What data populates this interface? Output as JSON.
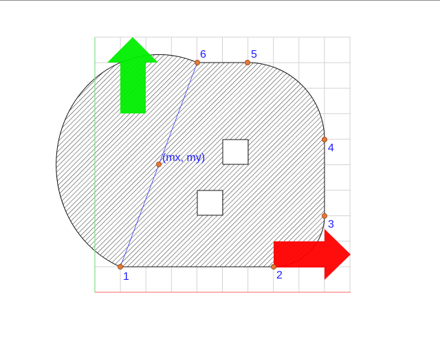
{
  "colors": {
    "grid": "#d2d2d2",
    "x_axis": "#ff8080",
    "y_axis": "#7fe07f",
    "hatch": "#111111",
    "shape_fill": "#ffffff",
    "outline": "#111111",
    "chord": "#4a4af0",
    "point_fill": "#e07a3a",
    "point_stroke": "#9a3f10",
    "label": "#1a1aff",
    "x_arrow": "#ff0000",
    "y_arrow": "#00ee00"
  },
  "points": [
    {
      "label": "1"
    },
    {
      "label": "2"
    },
    {
      "label": "3"
    },
    {
      "label": "4"
    },
    {
      "label": "5"
    },
    {
      "label": "6"
    }
  ],
  "midpoint": {
    "label": "(mx, my)"
  },
  "icons": {
    "x_axis_arrow": "arrow-right-icon",
    "y_axis_arrow": "arrow-up-icon"
  }
}
